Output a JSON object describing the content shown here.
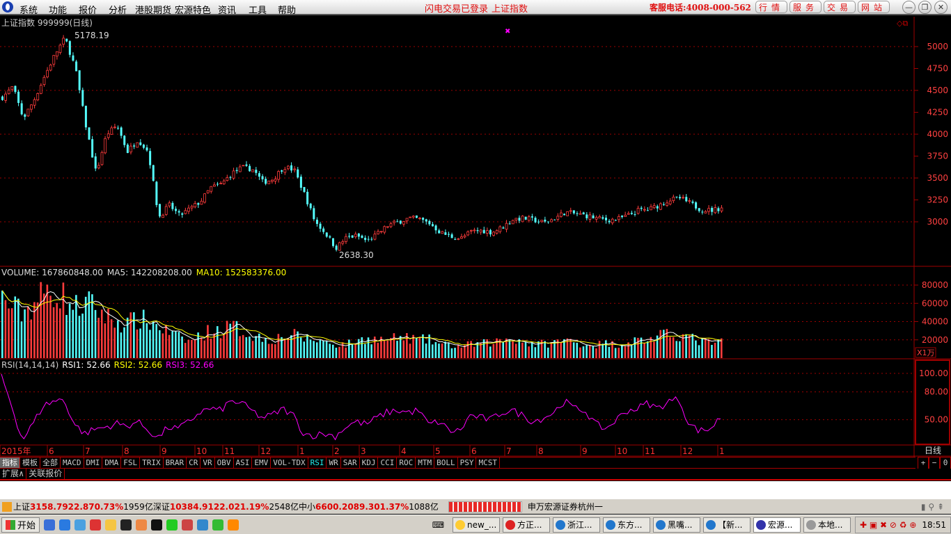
{
  "menubar": {
    "items": [
      "系统",
      "功能",
      "报价",
      "分析",
      "港股期货",
      "宏源特色",
      "资讯",
      "工具",
      "帮助"
    ],
    "status1": "闪电交易已登录",
    "status2": "上证指数",
    "hotline": "客服电话:4008-000-562",
    "buttons": [
      "行情",
      "服务",
      "交易",
      "网站"
    ]
  },
  "chart": {
    "title": "上证指数 999999(日线)",
    "high_label": "5178.19",
    "low_label": "2638.30",
    "volume_header": {
      "vol": "VOLUME: 167860848.00",
      "ma5": "MA5: 142208208.00",
      "ma10": "MA10: 152583376.00"
    },
    "rsi_header": {
      "name": "RSI(14,14,14)",
      "rsi1": "RSI1: 52.66",
      "rsi2": "RSI2: 52.66",
      "rsi3": "RSI3: 52.66"
    },
    "volume_unit": "X1万",
    "period_label": "日线",
    "zoom_buttons": [
      "+",
      "−",
      "0"
    ]
  },
  "chart_data": {
    "type": "candlestick",
    "price_axis_ticks": [
      5000,
      4750,
      4500,
      4250,
      4000,
      3750,
      3500,
      3250,
      3000
    ],
    "volume_axis_ticks": [
      80000,
      60000,
      40000,
      20000
    ],
    "rsi_axis_ticks": [
      "100.00",
      "80.00",
      "50.00"
    ],
    "x_tick_labels": [
      "2015年",
      "6",
      "7",
      "8",
      "9",
      "10",
      "11",
      "12",
      "1",
      "2",
      "3",
      "4",
      "5",
      "6",
      "7",
      "8",
      "9",
      "10",
      "11",
      "12",
      "1"
    ],
    "price_close_approx": [
      4420,
      4540,
      4180,
      4380,
      4650,
      4900,
      5100,
      4750,
      4100,
      3550,
      4000,
      4100,
      3800,
      3940,
      3800,
      3050,
      3190,
      3070,
      3150,
      3230,
      3390,
      3430,
      3550,
      3620,
      3600,
      3450,
      3490,
      3630,
      3590,
      3310,
      3000,
      2870,
      2700,
      2820,
      2840,
      2780,
      2860,
      2960,
      3000,
      3040,
      3030,
      2980,
      2880,
      2830,
      2810,
      2890,
      2900,
      2880,
      2940,
      3030,
      3040,
      3020,
      2990,
      3040,
      3110,
      3090,
      3070,
      3040,
      3020,
      3030,
      3070,
      3130,
      3140,
      3190,
      3250,
      3270,
      3210,
      3140,
      3130,
      3158.79
    ],
    "volume_approx": [
      65000,
      55000,
      50000,
      60000,
      70000,
      75000,
      65000,
      55000,
      60000,
      55000,
      45000,
      40000,
      38000,
      42000,
      40000,
      35000,
      28000,
      22000,
      18000,
      25000,
      30000,
      30000,
      35000,
      30000,
      25000,
      22000,
      20000,
      25000,
      25000,
      22000,
      20000,
      18000,
      15000,
      15000,
      18000,
      22000,
      20000,
      20000,
      22000,
      22000,
      20000,
      20000,
      15000,
      14000,
      13000,
      15000,
      16000,
      17000,
      20000,
      22000,
      18000,
      15000,
      16000,
      17000,
      20000,
      17000,
      15000,
      15000,
      16000,
      15000,
      17000,
      20000,
      20000,
      24000,
      25000,
      26000,
      22000,
      18000,
      17000,
      16786
    ],
    "rsi_approx": [
      98,
      65,
      28,
      45,
      65,
      70,
      72,
      45,
      35,
      40,
      42,
      46,
      43,
      48,
      40,
      30,
      42,
      40,
      48,
      58,
      62,
      60,
      70,
      68,
      60,
      52,
      55,
      62,
      55,
      35,
      33,
      35,
      32,
      42,
      48,
      45,
      52,
      58,
      60,
      58,
      60,
      45,
      48,
      38,
      38,
      55,
      52,
      50,
      58,
      60,
      55,
      48,
      52,
      58,
      70,
      62,
      60,
      45,
      40,
      50,
      60,
      62,
      68,
      62,
      70,
      72,
      45,
      38,
      40,
      52.66
    ],
    "high": 5178.19,
    "low": 2638.3,
    "colors": {
      "up": "#ff3c3c",
      "down": "#54fcfc",
      "ma5": "#ffffff",
      "ma10": "#ffff00",
      "rsi": "#ff00ff",
      "grid": "#a00000"
    }
  },
  "tabs": [
    "指标",
    "模板",
    "全部",
    "MACD",
    "DMI",
    "DMA",
    "FSL",
    "TRIX",
    "BRAR",
    "CR",
    "VR",
    "OBV",
    "ASI",
    "EMV",
    "VOL-TDX",
    "RSI",
    "WR",
    "SAR",
    "KDJ",
    "CCI",
    "ROC",
    "MTM",
    "BOLL",
    "PSY",
    "MCST"
  ],
  "ext_tabs": [
    "扩展∧",
    "关联报价"
  ],
  "status": {
    "sh_name": "上证",
    "sh_val": "3158.79",
    "sh_chg": "22.87",
    "sh_pct": "0.73%",
    "sh_amt": "1959亿",
    "sz_name": "深证",
    "sz_val": "10384.9",
    "sz_chg": "122.02",
    "sz_pct": "1.19%",
    "sz_amt": "2548亿",
    "zx_name": "中小",
    "zx_val": "6600.20",
    "zx_chg": "89.30",
    "zx_pct": "1.37%",
    "zx_amt": "1088亿",
    "broker": "申万宏源证券杭州一"
  },
  "taskbar": {
    "start": "开始",
    "tasks": [
      "new_...",
      "方正...",
      "浙江...",
      "东方...",
      "黑嘴...",
      "【新...",
      "宏源...",
      "本地..."
    ],
    "clock": "18:51"
  }
}
